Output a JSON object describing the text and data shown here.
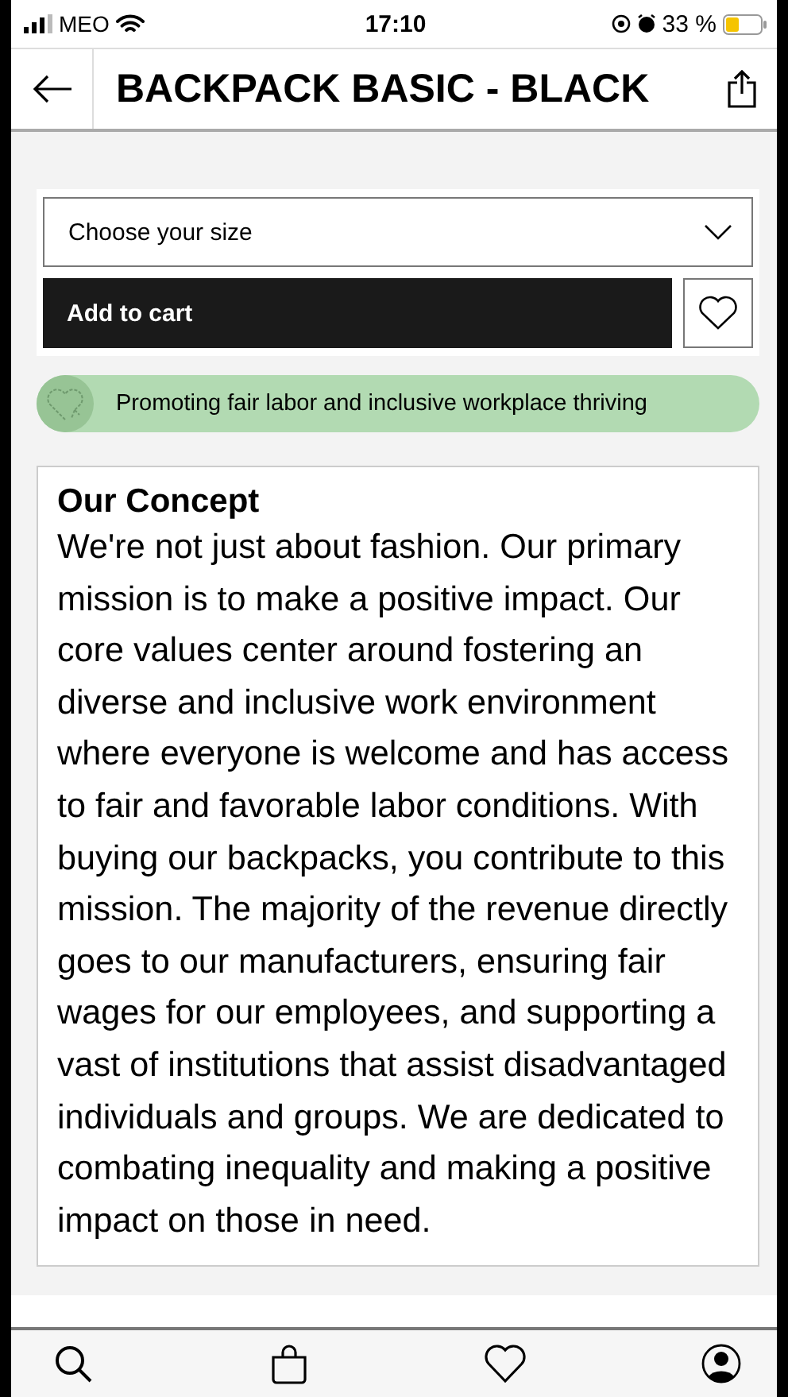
{
  "status_bar": {
    "carrier": "MEO",
    "time": "17:10",
    "battery": "33 %"
  },
  "header": {
    "title": "BACKPACK BASIC - BLACK"
  },
  "size_select": {
    "placeholder": "Choose your size"
  },
  "add_button": "Add to cart",
  "banner": "Promoting fair labor and inclusive workplace thriving",
  "concept": {
    "title": "Our Concept",
    "body": "We're not just about fashion. Our primary mission is to make a positive impact. Our core values center around fostering an diverse and inclusive work environment where everyone is welcome and has access to fair and favorable labor conditions. With buying our backpacks, you contribute to this mission. The majority of the revenue directly goes to our manufacturers, ensuring fair wages for our employees, and supporting a vast of institutions that assist disadvantaged individuals and groups. We are dedicated to combating inequality and making a positive impact on those in need."
  },
  "tab_bar": [
    {
      "kind": "search"
    },
    {
      "kind": "bag"
    },
    {
      "kind": "heart"
    },
    {
      "kind": "profile"
    }
  ]
}
